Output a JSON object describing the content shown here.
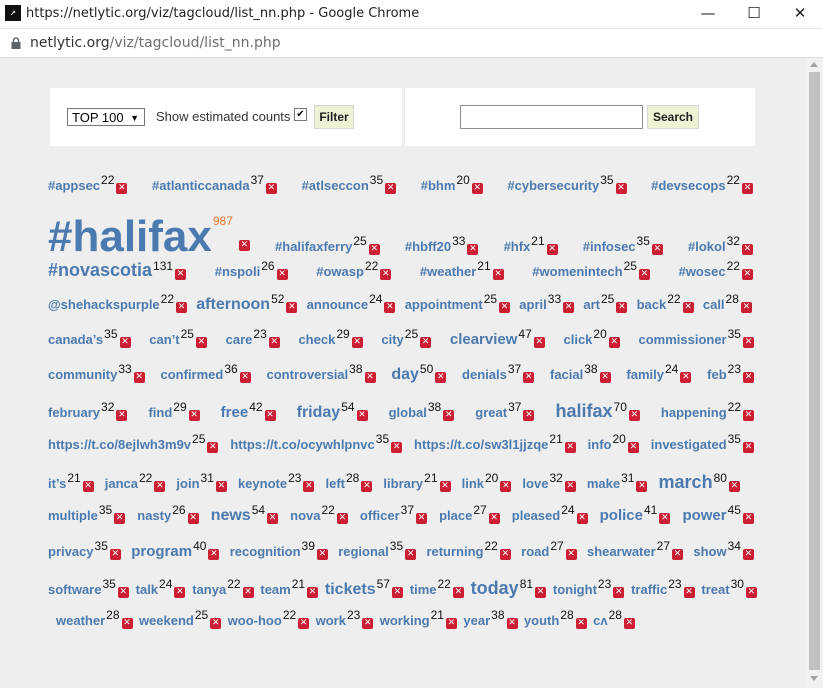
{
  "window": {
    "app_icon": "netlytic-icon",
    "title": "https://netlytic.org/viz/tagcloud/list_nn.php - Google Chrome",
    "min_symbol": "—",
    "max_symbol": "☐",
    "close_symbol": "✕"
  },
  "address": {
    "host": "netlytic.org",
    "path": "/viz/tagcloud/list_nn.php"
  },
  "controls": {
    "top_select": "TOP 100",
    "show_estimated_label": "Show estimated counts",
    "show_estimated_checked": true,
    "filter_label": "Filter",
    "search_value": "",
    "search_label": "Search"
  },
  "colors": {
    "tag": "#4a7aaf",
    "highlight_count": "#e8772e",
    "delete": "#cc1f34"
  },
  "tag_rows": [
    [
      [
        "#appsec",
        22
      ],
      [
        "#atlanticcanada",
        37
      ],
      [
        "#atlseccon",
        35
      ],
      [
        "#bhm",
        20
      ],
      [
        "#cybersecurity",
        35
      ],
      [
        "#devsecops",
        22
      ]
    ],
    [
      [
        "#halifax",
        987
      ],
      [
        "#halifaxferry",
        25
      ],
      [
        "#hbff20",
        33
      ],
      [
        "#hfx",
        21
      ],
      [
        "#infosec",
        35
      ],
      [
        "#lokol",
        32
      ]
    ],
    [
      [
        "#novascotia",
        131
      ],
      [
        "#nspoli",
        26
      ],
      [
        "#owasp",
        22
      ],
      [
        "#weather",
        21
      ],
      [
        "#womenintech",
        25
      ],
      [
        "#wosec",
        22
      ]
    ],
    [
      [
        "@shehackspurple",
        22
      ],
      [
        "afternoon",
        52
      ],
      [
        "announce",
        24
      ],
      [
        "appointment",
        25
      ],
      [
        "april",
        33
      ],
      [
        "art",
        25
      ],
      [
        "back",
        22
      ],
      [
        "call",
        28
      ]
    ],
    [
      [
        "canada’s",
        35
      ],
      [
        "can’t",
        25
      ],
      [
        "care",
        23
      ],
      [
        "check",
        29
      ],
      [
        "city",
        25
      ],
      [
        "clearview",
        47
      ],
      [
        "click",
        20
      ],
      [
        "commissioner",
        35
      ]
    ],
    [
      [
        "community",
        33
      ],
      [
        "confirmed",
        36
      ],
      [
        "controversial",
        38
      ],
      [
        "day",
        50
      ],
      [
        "denials",
        37
      ],
      [
        "facial",
        38
      ],
      [
        "family",
        24
      ],
      [
        "feb",
        23
      ]
    ],
    [
      [
        "february",
        32
      ],
      [
        "find",
        29
      ],
      [
        "free",
        42
      ],
      [
        "friday",
        54
      ],
      [
        "global",
        38
      ],
      [
        "great",
        37
      ],
      [
        "halifax",
        70
      ],
      [
        "happening",
        22
      ]
    ],
    [
      [
        "https://t.co/8ejlwh3m9v",
        25
      ],
      [
        "https://t.co/ocywhlpnvc",
        35
      ],
      [
        "https://t.co/sw3l1jjzqe",
        21
      ],
      [
        "info",
        20
      ],
      [
        "investigated",
        35
      ]
    ],
    [
      [
        "it’s",
        21
      ],
      [
        "janca",
        22
      ],
      [
        "join",
        31
      ],
      [
        "keynote",
        23
      ],
      [
        "left",
        28
      ],
      [
        "library",
        21
      ],
      [
        "link",
        20
      ],
      [
        "love",
        32
      ],
      [
        "make",
        31
      ],
      [
        "march",
        80
      ]
    ],
    [
      [
        "multiple",
        35
      ],
      [
        "nasty",
        26
      ],
      [
        "news",
        54
      ],
      [
        "nova",
        22
      ],
      [
        "officer",
        37
      ],
      [
        "place",
        27
      ],
      [
        "pleased",
        24
      ],
      [
        "police",
        41
      ],
      [
        "power",
        45
      ]
    ],
    [
      [
        "privacy",
        35
      ],
      [
        "program",
        40
      ],
      [
        "recognition",
        39
      ],
      [
        "regional",
        35
      ],
      [
        "returning",
        22
      ],
      [
        "road",
        27
      ],
      [
        "shearwater",
        27
      ],
      [
        "show",
        34
      ]
    ],
    [
      [
        "software",
        35
      ],
      [
        "talk",
        24
      ],
      [
        "tanya",
        22
      ],
      [
        "team",
        21
      ],
      [
        "tickets",
        57
      ],
      [
        "time",
        22
      ],
      [
        "today",
        81
      ],
      [
        "tonight",
        23
      ],
      [
        "traffic",
        23
      ],
      [
        "treat",
        30
      ]
    ],
    [
      [
        "weather",
        28
      ],
      [
        "weekend",
        25
      ],
      [
        "woo-hoo",
        22
      ],
      [
        "work",
        23
      ],
      [
        "working",
        21
      ],
      [
        "year",
        38
      ],
      [
        "youth",
        28
      ],
      [
        "cʌ",
        28
      ]
    ]
  ]
}
